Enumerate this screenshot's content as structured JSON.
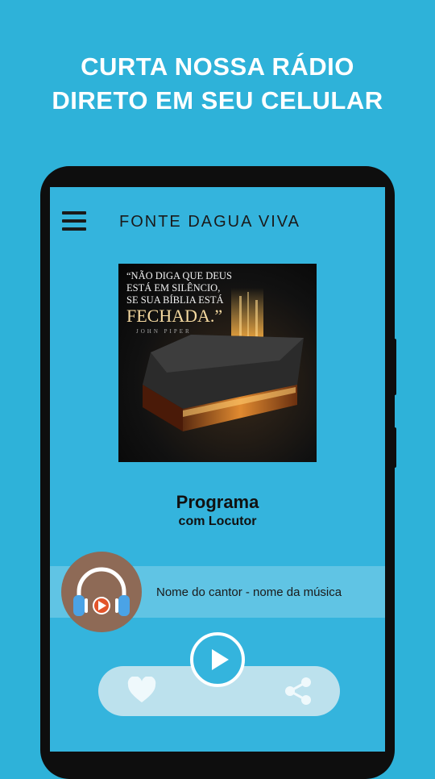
{
  "headline": {
    "line1": "CURTA NOSSA RÁDIO",
    "line2": "DIRETO EM SEU CELULAR"
  },
  "app": {
    "title": "FONTE DAGUA VIVA",
    "menu_icon": "hamburger-menu-icon"
  },
  "cover": {
    "quote_line1": "“Não diga que Deus",
    "quote_line2": "está em silêncio,",
    "quote_line3": "se sua Bíblia está",
    "quote_big": "Fechada.”",
    "author": "JOHN PIPER"
  },
  "program": {
    "title": "Programa",
    "subtitle": "com Locutor"
  },
  "now_playing": {
    "text": "Nome do cantor - nome da música"
  },
  "controls": {
    "play_icon": "play-icon",
    "like_icon": "heart-icon",
    "share_icon": "share-icon"
  },
  "colors": {
    "background": "#2eb2d9",
    "screen": "#34b4dd",
    "avatar": "#8e6a56",
    "bottom_bar": "#c8e5ef"
  }
}
